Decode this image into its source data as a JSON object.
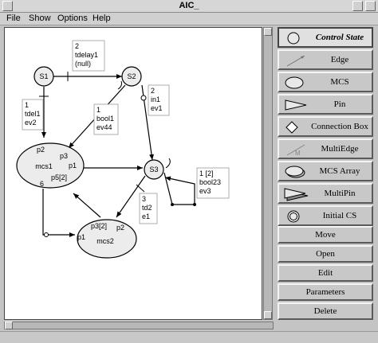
{
  "window": {
    "title": "AIC_"
  },
  "menu": [
    "File",
    "Show",
    "Options",
    "Help"
  ],
  "tools": [
    {
      "label": "Control State",
      "icon": "control-state-icon",
      "selected": true
    },
    {
      "label": "Edge",
      "icon": "edge-icon",
      "selected": false
    },
    {
      "label": "MCS",
      "icon": "mcs-icon",
      "selected": false
    },
    {
      "label": "Pin",
      "icon": "pin-icon",
      "selected": false
    },
    {
      "label": "Connection Box",
      "icon": "connection-box-icon",
      "selected": false
    },
    {
      "label": "MultiEdge",
      "icon": "multiedge-icon",
      "selected": false
    },
    {
      "label": "MCS Array",
      "icon": "mcs-array-icon",
      "selected": false
    },
    {
      "label": "MultiPin",
      "icon": "multipin-icon",
      "selected": false
    },
    {
      "label": "Initial CS",
      "icon": "initial-cs-icon",
      "selected": false
    }
  ],
  "actions": [
    "Move",
    "Open",
    "Edit",
    "Parameters",
    "Delete"
  ],
  "diagram": {
    "states": {
      "s1": "S1",
      "s2": "S2",
      "s3": "S3"
    },
    "mcs1": {
      "name": "mcs1",
      "pins": [
        "p2",
        "p3",
        "p1",
        "p5[2]",
        "6"
      ]
    },
    "mcs2": {
      "name": "mcs2",
      "pins": [
        "p3[2]",
        "p2",
        "p1"
      ]
    },
    "edge_labels": {
      "s1_s2": [
        "2",
        "tdelay1",
        "(null)"
      ],
      "s1_mcs1": [
        "1",
        "tdel1",
        "ev2"
      ],
      "s2_mcs1": [
        "1",
        "bool1",
        "ev44"
      ],
      "s2_s3": [
        "2",
        "in1",
        "ev1"
      ],
      "s3_self": [
        "1   [2]",
        "bool23",
        "ev3"
      ],
      "s3_mcs2": [
        "3",
        "td2",
        "e1"
      ]
    }
  }
}
